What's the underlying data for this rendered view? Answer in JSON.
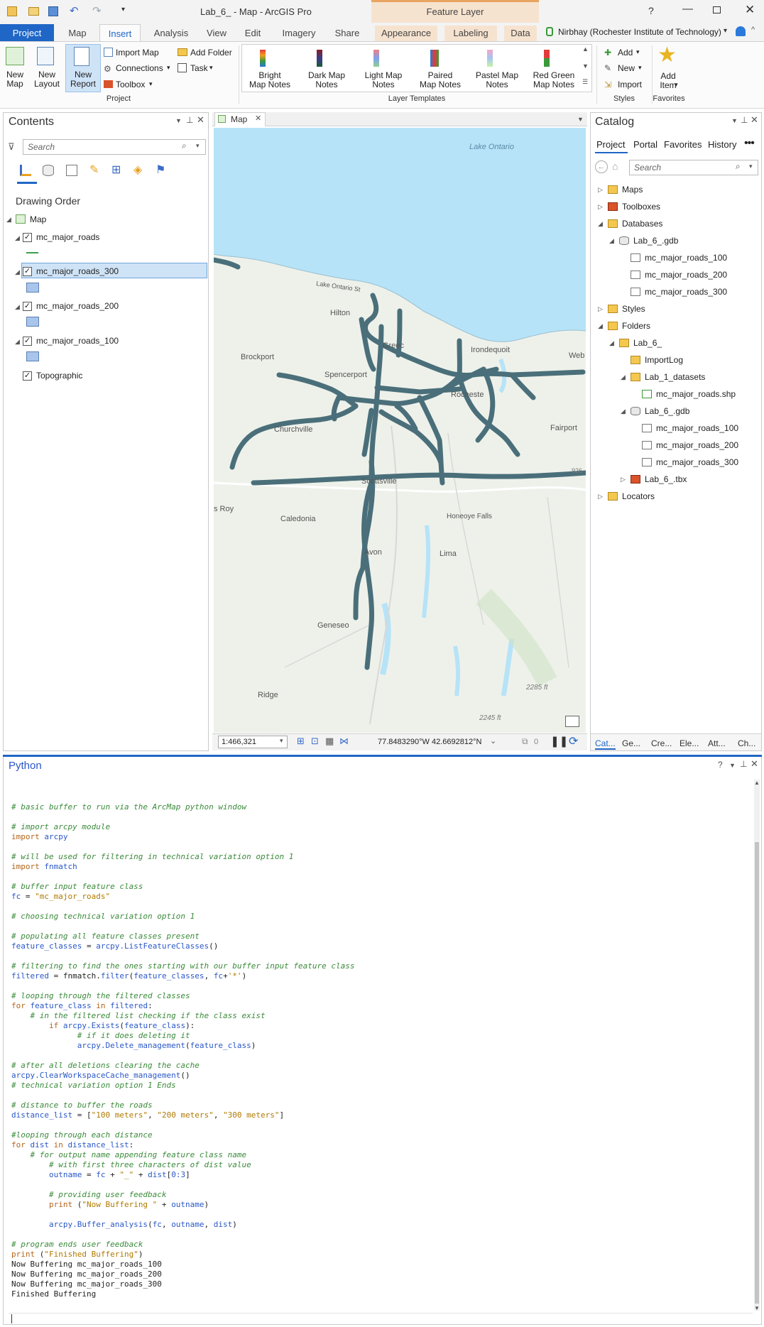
{
  "titlebar": {
    "title": "Lab_6_ - Map - ArcGIS Pro",
    "context_tab": "Feature Layer",
    "help": "?"
  },
  "tabs": [
    "Project",
    "Map",
    "Insert",
    "Analysis",
    "View",
    "Edit",
    "Imagery",
    "Share",
    "Appearance",
    "Labeling",
    "Data"
  ],
  "user": {
    "name": "Nirbhay (Rochester Institute of Technology)"
  },
  "ribbon": {
    "new_map": "New\nMap",
    "new_layout": "New\nLayout",
    "new_report": "New\nReport",
    "import_map": "Import Map",
    "connections": "Connections",
    "toolbox": "Toolbox",
    "add_folder": "Add Folder",
    "task": "Task",
    "project_group": "Project",
    "templates": [
      {
        "label": "Bright\nMap Notes"
      },
      {
        "label": "Dark Map\nNotes"
      },
      {
        "label": "Light Map\nNotes"
      },
      {
        "label": "Paired\nMap Notes"
      },
      {
        "label": "Pastel Map\nNotes"
      },
      {
        "label": "Red Green\nMap Notes"
      }
    ],
    "layer_templates_group": "Layer Templates",
    "add": "Add",
    "new": "New",
    "import": "Import",
    "styles_group": "Styles",
    "add_item": "Add\nItem",
    "favorites_group": "Favorites"
  },
  "contents": {
    "title": "Contents",
    "search_placeholder": "Search",
    "drawing_order": "Drawing Order",
    "map": "Map",
    "layers": [
      {
        "name": "mc_major_roads",
        "symbol": "line"
      },
      {
        "name": "mc_major_roads_300",
        "symbol": "poly",
        "selected": true
      },
      {
        "name": "mc_major_roads_200",
        "symbol": "poly"
      },
      {
        "name": "mc_major_roads_100",
        "symbol": "poly"
      }
    ],
    "basemap": "Topographic"
  },
  "map": {
    "tab": "Map",
    "labels": {
      "lake": "Lake Ontario",
      "lake_shore": "Lake Ontario St",
      "hilton": "Hilton",
      "greece": "Greec",
      "irondequoit": "Irondequoit",
      "brockport": "Brockport",
      "spencerport": "Spencerport",
      "rochester": "Rocheste",
      "churchville": "Churchville",
      "fairport": "Fairport",
      "scottsville": "Scottsville",
      "roy": "s Roy",
      "caledonia": "Caledonia",
      "honeoye": "Honeoye\nFalls",
      "avon": "Avon",
      "lima": "Lima",
      "geneseo": "Geneseo",
      "ridge": "Ridge",
      "ft2285": "2285 ft",
      "ft2245": "2245 ft",
      "web": "Web",
      "n926": "926"
    },
    "scale": "1:466,321",
    "coords": "77.8483290°W 42.6692812°N",
    "selected_count": "0"
  },
  "catalog": {
    "title": "Catalog",
    "tabs": [
      "Project",
      "Portal",
      "Favorites",
      "History"
    ],
    "search_placeholder": "Search",
    "items": [
      {
        "label": "Maps",
        "level": 0,
        "expand": "collapsed",
        "icon": "maps-icon"
      },
      {
        "label": "Toolboxes",
        "level": 0,
        "expand": "collapsed",
        "icon": "toolboxes-icon"
      },
      {
        "label": "Databases",
        "level": 0,
        "expand": "expanded",
        "icon": "databases-icon"
      },
      {
        "label": "Lab_6_.gdb",
        "level": 1,
        "expand": "expanded",
        "icon": "gdb-icon"
      },
      {
        "label": "mc_major_roads_100",
        "level": 2,
        "expand": "none",
        "icon": "feature-class-icon"
      },
      {
        "label": "mc_major_roads_200",
        "level": 2,
        "expand": "none",
        "icon": "feature-class-icon"
      },
      {
        "label": "mc_major_roads_300",
        "level": 2,
        "expand": "none",
        "icon": "feature-class-icon"
      },
      {
        "label": "Styles",
        "level": 0,
        "expand": "collapsed",
        "icon": "styles-icon"
      },
      {
        "label": "Folders",
        "level": 0,
        "expand": "expanded",
        "icon": "folders-icon"
      },
      {
        "label": "Lab_6_",
        "level": 1,
        "expand": "expanded",
        "icon": "folder-icon"
      },
      {
        "label": "ImportLog",
        "level": 2,
        "expand": "none",
        "icon": "folder-icon"
      },
      {
        "label": "Lab_1_datasets",
        "level": 2,
        "expand": "expanded",
        "icon": "folder-icon"
      },
      {
        "label": "mc_major_roads.shp",
        "level": 3,
        "expand": "none",
        "icon": "shapefile-icon"
      },
      {
        "label": "Lab_6_.gdb",
        "level": 2,
        "expand": "expanded",
        "icon": "gdb-icon"
      },
      {
        "label": "mc_major_roads_100",
        "level": 3,
        "expand": "none",
        "icon": "feature-class-icon"
      },
      {
        "label": "mc_major_roads_200",
        "level": 3,
        "expand": "none",
        "icon": "feature-class-icon"
      },
      {
        "label": "mc_major_roads_300",
        "level": 3,
        "expand": "none",
        "icon": "feature-class-icon"
      },
      {
        "label": "Lab_6_.tbx",
        "level": 2,
        "expand": "collapsed",
        "icon": "toolbox-icon"
      },
      {
        "label": "Locators",
        "level": 0,
        "expand": "collapsed",
        "icon": "locators-icon"
      }
    ],
    "bottom_tabs": [
      "Cat...",
      "Ge...",
      "Cre...",
      "Ele...",
      "Att...",
      "Ch..."
    ]
  },
  "python": {
    "title": "Python",
    "lines": [
      [
        [
          "cm",
          "# basic buffer to run via the ArcMap python window"
        ]
      ],
      [],
      [
        [
          "cm",
          "# import arcpy module"
        ]
      ],
      [
        [
          "kw",
          "import "
        ],
        [
          "nm",
          "arcpy"
        ]
      ],
      [],
      [
        [
          "cm",
          "# will be used for filtering in technical variation option 1"
        ]
      ],
      [
        [
          "kw",
          "import "
        ],
        [
          "nm",
          "fnmatch"
        ]
      ],
      [],
      [
        [
          "cm",
          "# buffer input feature class"
        ]
      ],
      [
        [
          "nm",
          "fc"
        ],
        [
          "pl",
          " = "
        ],
        [
          "st",
          "\"mc_major_roads\""
        ]
      ],
      [],
      [
        [
          "cm",
          "# choosing technical variation option 1"
        ]
      ],
      [],
      [
        [
          "cm",
          "# populating all feature classes present"
        ]
      ],
      [
        [
          "nm",
          "feature_classes"
        ],
        [
          "pl",
          " = "
        ],
        [
          "nm",
          "arcpy.ListFeatureClasses"
        ],
        [
          "pl",
          "()"
        ]
      ],
      [],
      [
        [
          "cm",
          "# filtering to find the ones starting with our buffer input feature class"
        ]
      ],
      [
        [
          "nm",
          "filtered"
        ],
        [
          "pl",
          " = fnmatch."
        ],
        [
          "nm",
          "filter"
        ],
        [
          "pl",
          "("
        ],
        [
          "nm",
          "feature_classes"
        ],
        [
          "pl",
          ", "
        ],
        [
          "nm",
          "fc"
        ],
        [
          "pl",
          "+"
        ],
        [
          "st",
          "'*'"
        ],
        [
          "pl",
          ")"
        ]
      ],
      [],
      [
        [
          "cm",
          "# looping through the filtered classes"
        ]
      ],
      [
        [
          "kw",
          "for "
        ],
        [
          "nm",
          "feature_class"
        ],
        [
          "kw",
          " in "
        ],
        [
          "nm",
          "filtered"
        ],
        [
          "pl",
          ":"
        ]
      ],
      [
        [
          "cm",
          "    # in the filtered list checking if the class exist"
        ]
      ],
      [
        [
          "kw",
          "        if "
        ],
        [
          "nm",
          "arcpy.Exists"
        ],
        [
          "pl",
          "("
        ],
        [
          "nm",
          "feature_class"
        ],
        [
          "pl",
          "):"
        ]
      ],
      [
        [
          "cm",
          "              # if it does deleting it"
        ]
      ],
      [
        [
          "nm",
          "              arcpy.Delete_management"
        ],
        [
          "pl",
          "("
        ],
        [
          "nm",
          "feature_class"
        ],
        [
          "pl",
          ")"
        ]
      ],
      [],
      [
        [
          "cm",
          "# after all deletions clearing the cache"
        ]
      ],
      [
        [
          "nm",
          "arcpy.ClearWorkspaceCache_management"
        ],
        [
          "pl",
          "()"
        ]
      ],
      [
        [
          "cm",
          "# technical variation option 1 Ends"
        ]
      ],
      [],
      [
        [
          "cm",
          "# distance to buffer the roads"
        ]
      ],
      [
        [
          "nm",
          "distance_list"
        ],
        [
          "pl",
          " = ["
        ],
        [
          "st",
          "\"100 meters\""
        ],
        [
          "pl",
          ", "
        ],
        [
          "st",
          "\"200 meters\""
        ],
        [
          "pl",
          ", "
        ],
        [
          "st",
          "\"300 meters\""
        ],
        [
          "pl",
          "]"
        ]
      ],
      [],
      [
        [
          "cm",
          "#looping through each distance"
        ]
      ],
      [
        [
          "kw",
          "for "
        ],
        [
          "nm",
          "dist"
        ],
        [
          "kw",
          " in "
        ],
        [
          "nm",
          "distance_list"
        ],
        [
          "pl",
          ":"
        ]
      ],
      [
        [
          "cm",
          "    # for output name appending feature class name"
        ]
      ],
      [
        [
          "cm",
          "        # with first three characters of dist value"
        ]
      ],
      [
        [
          "nm",
          "        outname"
        ],
        [
          "pl",
          " = "
        ],
        [
          "nm",
          "fc"
        ],
        [
          "pl",
          " + "
        ],
        [
          "st",
          "\"_\""
        ],
        [
          "pl",
          " + "
        ],
        [
          "nm",
          "dist"
        ],
        [
          "pl",
          "["
        ],
        [
          "nm",
          "0:3"
        ],
        [
          "pl",
          "]"
        ]
      ],
      [],
      [
        [
          "cm",
          "        # providing user feedback"
        ]
      ],
      [
        [
          "kw",
          "        print "
        ],
        [
          "pl",
          "("
        ],
        [
          "st",
          "\"Now Buffering \""
        ],
        [
          "pl",
          " + "
        ],
        [
          "nm",
          "outname"
        ],
        [
          "pl",
          ")"
        ]
      ],
      [],
      [
        [
          "nm",
          "        arcpy.Buffer_analysis"
        ],
        [
          "pl",
          "("
        ],
        [
          "nm",
          "fc"
        ],
        [
          "pl",
          ", "
        ],
        [
          "nm",
          "outname"
        ],
        [
          "pl",
          ", "
        ],
        [
          "nm",
          "dist"
        ],
        [
          "pl",
          ")"
        ]
      ],
      [],
      [
        [
          "cm",
          "# program ends user feedback"
        ]
      ],
      [
        [
          "kw",
          "print "
        ],
        [
          "pl",
          "("
        ],
        [
          "st",
          "\"Finished Buffering\""
        ],
        [
          "pl",
          ")"
        ]
      ],
      [
        [
          "out",
          "Now Buffering mc_major_roads_100"
        ]
      ],
      [
        [
          "out",
          "Now Buffering mc_major_roads_200"
        ]
      ],
      [
        [
          "out",
          "Now Buffering mc_major_roads_300"
        ]
      ],
      [
        [
          "out",
          "Finished Buffering"
        ]
      ]
    ]
  },
  "colors": {
    "accent": "#1f66c6",
    "road": "#4a6f7a",
    "lake": "#b6e3f7"
  }
}
